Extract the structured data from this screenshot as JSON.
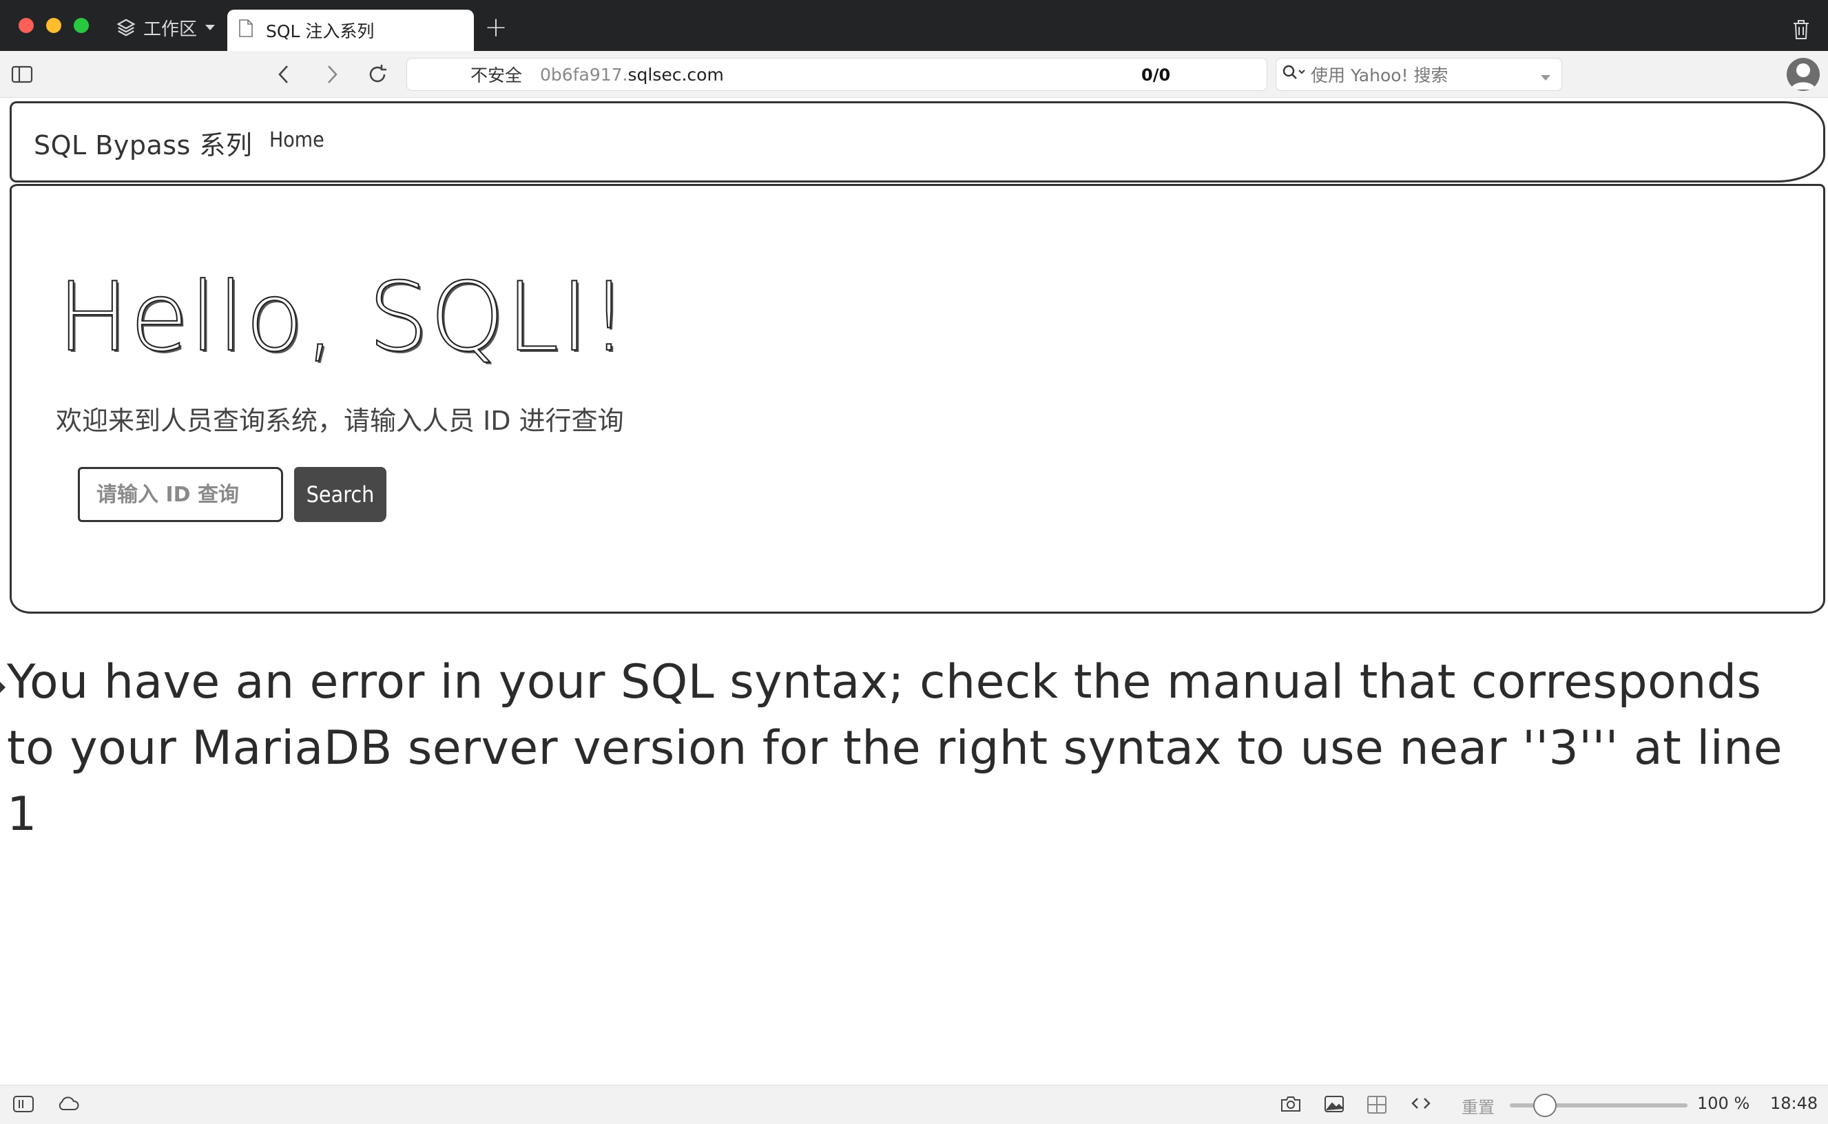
{
  "browser": {
    "workspace_label": "工作区",
    "tab_title": "SQL 注入系列",
    "new_tab_symbol": "+",
    "url": {
      "security_label": "不安全",
      "host_sub": "0b6fa917.",
      "host_domain": "sqlsec.com",
      "match_count": "0/0"
    },
    "search_placeholder": "使用 Yahoo! 搜索"
  },
  "page": {
    "brand": "SQL Bypass 系列",
    "nav_home": "Home",
    "hero_title": "Hello, SQLI!",
    "hero_subtitle": "欢迎来到人员查询系统，请输入人员 ID 进行查询",
    "search_input": {
      "value": "",
      "placeholder": "请输入 ID 查询"
    },
    "search_button": "Search",
    "error_message": "You have an error in your SQL syntax; check the manual that corresponds to your MariaDB server version for the right syntax to use near ''3''' at line 1"
  },
  "statusbar": {
    "reset_label": "重置",
    "zoom": "100 %",
    "zoom_percent": 100,
    "time": "18:48"
  }
}
